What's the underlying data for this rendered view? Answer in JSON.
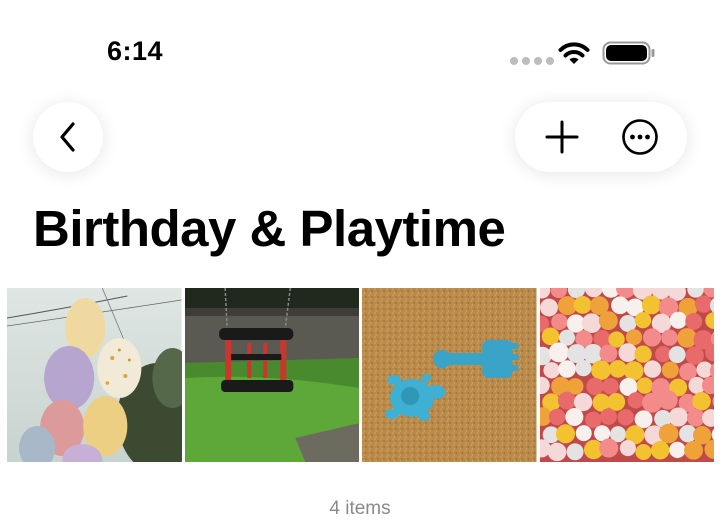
{
  "status_bar": {
    "time": "6:14",
    "icons": [
      "signal-dots-icon",
      "wifi-icon",
      "battery-icon"
    ]
  },
  "nav": {
    "back_icon": "chevron-left-icon",
    "add_icon": "plus-icon",
    "more_icon": "ellipsis-circle-icon"
  },
  "album": {
    "title": "Birthday & Playtime",
    "photos": [
      {
        "name": "balloons-photo"
      },
      {
        "name": "swing-photo"
      },
      {
        "name": "sand-toy-photo"
      },
      {
        "name": "ball-pit-photo"
      }
    ],
    "item_count": "4 items"
  },
  "colors": {
    "background": "#ffffff",
    "text": "#000000",
    "secondary_text": "#8a8a8a"
  }
}
